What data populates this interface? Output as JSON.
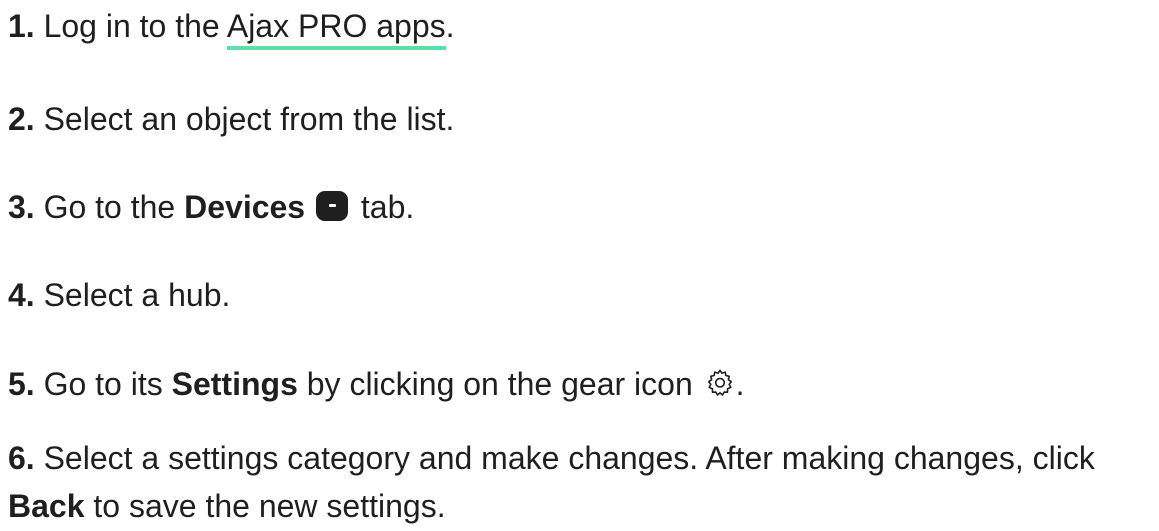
{
  "steps": [
    {
      "num": "1.",
      "pre": "Log in to the ",
      "link": "Ajax PRO apps",
      "post": "."
    },
    {
      "num": "2.",
      "text": "Select an object from the list."
    },
    {
      "num": "3.",
      "pre": "Go to the ",
      "bold": "Devices",
      "icon": "devices-tab-icon",
      "post": " tab."
    },
    {
      "num": "4.",
      "text": "Select a hub."
    },
    {
      "num": "5.",
      "pre": "Go to its ",
      "bold": "Settings",
      "mid": " by clicking on the gear icon ",
      "icon": "gear-icon",
      "post": "."
    },
    {
      "num": "6.",
      "pre": "Select a settings category and make changes. After making changes, click ",
      "bold": "Back",
      "post": " to save the new settings."
    }
  ],
  "colors": {
    "link_underline": "#5ce0a8",
    "text": "#1f1f1f"
  }
}
